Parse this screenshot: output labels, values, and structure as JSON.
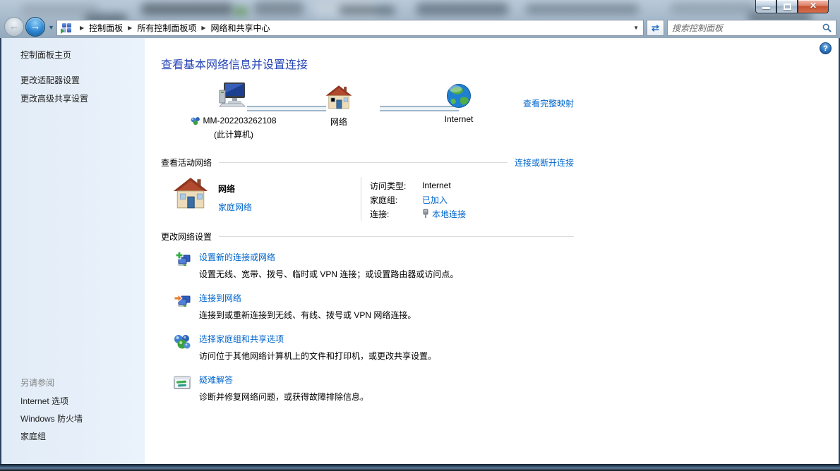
{
  "window": {
    "close_glyph": "✕"
  },
  "navigation": {
    "back_glyph": "←",
    "forward_glyph": "→",
    "recent_chevron": "▼",
    "breadcrumb": [
      "控制面板",
      "所有控制面板项",
      "网络和共享中心"
    ],
    "breadcrumb_arrow": "▶",
    "address_dropdown": "▼",
    "refresh_glyph": "⇄",
    "search": {
      "placeholder": "搜索控制面板"
    }
  },
  "sidebar": {
    "items": [
      "控制面板主页",
      "更改适配器设置",
      "更改高级共享设置"
    ],
    "see_also": {
      "header": "另请参阅",
      "items": [
        "Internet 选项",
        "Windows 防火墙",
        "家庭组"
      ]
    }
  },
  "main": {
    "help_glyph": "?",
    "title": "查看基本网络信息并设置连接",
    "map": {
      "computer_label": "MM-202203262108",
      "computer_sublabel": "(此计算机)",
      "network_label": "网络",
      "internet_label": "Internet",
      "full_map_link": "查看完整映射"
    },
    "active_networks": {
      "header": "查看活动网络",
      "connect_link": "连接或断开连接",
      "network_name": "网络",
      "network_type": "家庭网络",
      "details": [
        {
          "label": "访问类型:",
          "value": "Internet"
        },
        {
          "label": "家庭组:",
          "value": "已加入"
        },
        {
          "label": "连接:",
          "value": "本地连接"
        }
      ]
    },
    "change_settings": {
      "header": "更改网络设置",
      "items": [
        {
          "title": "设置新的连接或网络",
          "description": "设置无线、宽带、拨号、临时或 VPN 连接；或设置路由器或访问点。"
        },
        {
          "title": "连接到网络",
          "description": "连接到或重新连接到无线、有线、拨号或 VPN 网络连接。"
        },
        {
          "title": "选择家庭组和共享选项",
          "description": "访问位于其他网络计算机上的文件和打印机，或更改共享设置。"
        },
        {
          "title": "疑难解答",
          "description": "诊断并修复网络问题，或获得故障排除信息。"
        }
      ]
    }
  },
  "colors": {
    "link": "#0066cc",
    "heading": "#2646b8",
    "close_button": "#c5502f"
  }
}
